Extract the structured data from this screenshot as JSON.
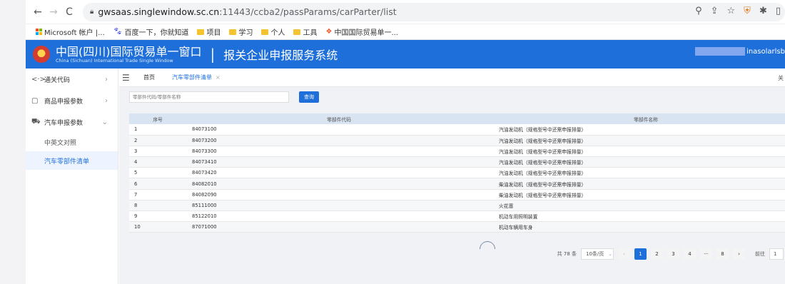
{
  "browser": {
    "url_domain": "gwsaas.singlewindow.sc.cn",
    "url_path": ":11443/ccba2/passParams/carParter/list",
    "bookmarks": [
      "Microsoft 帐户 |...",
      "百度一下，你就知道",
      "项目",
      "学习",
      "个人",
      "工具",
      "中国国际贸易单一..."
    ]
  },
  "app": {
    "title_cn": "中国(四川)国际贸易单一窗口",
    "title_en": "China (Sichuan) International Trade Single Window",
    "separator": "|",
    "system_name": "报关企业申报服务系统",
    "user": "inasolarlsb"
  },
  "sidebar": {
    "items": [
      {
        "label": "通关代码",
        "icon": "<·>"
      },
      {
        "label": "商品申报参数",
        "icon": "▢"
      },
      {
        "label": "汽车申报参数",
        "icon": "⛟"
      }
    ],
    "subitems": [
      "中英文对照",
      "汽车零部件清单"
    ]
  },
  "tabs": {
    "home": "首页",
    "active": "汽车零部件清单",
    "close_all": "关"
  },
  "search": {
    "placeholder": "零部件代码/零部件名称",
    "button": "查询"
  },
  "table": {
    "headers": [
      "序号",
      "零部件代码",
      "零部件名称"
    ],
    "rows": [
      [
        "1",
        "84073100",
        "汽油发动机（规格型号中还需申报排量）"
      ],
      [
        "2",
        "84073200",
        "汽油发动机（规格型号中还需申报排量）"
      ],
      [
        "3",
        "84073300",
        "汽油发动机（规格型号中还需申报排量）"
      ],
      [
        "4",
        "84073410",
        "汽油发动机（规格型号中还需申报排量）"
      ],
      [
        "5",
        "84073420",
        "汽油发动机（规格型号中还需申报排量）"
      ],
      [
        "6",
        "84082010",
        "柴油发动机（规格型号中还需申报排量）"
      ],
      [
        "7",
        "84082090",
        "柴油发动机（规格型号中还需申报排量）"
      ],
      [
        "8",
        "85111000",
        "火花塞"
      ],
      [
        "9",
        "85122010",
        "机动车用照明装置"
      ],
      [
        "10",
        "87071000",
        "机动车辆用车身"
      ]
    ]
  },
  "pagination": {
    "total": "共 78 条",
    "page_size": "10条/页",
    "pages": [
      "1",
      "2",
      "3",
      "4",
      "···",
      "8"
    ],
    "current": "1",
    "goto_label": "前往",
    "goto_value": "1"
  },
  "colors": {
    "primary": "#1e6fd9",
    "header_row": "#d9e4f3",
    "content_bg": "#f0f2f5"
  }
}
